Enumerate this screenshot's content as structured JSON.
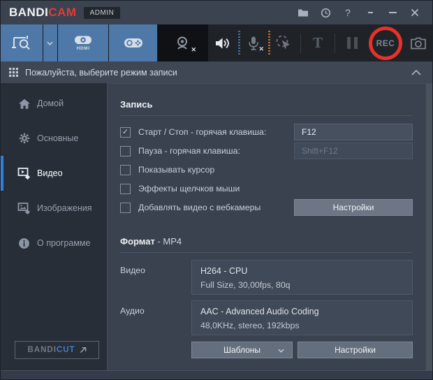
{
  "titlebar": {
    "logo_primary": "BANDI",
    "logo_accent": "CAM",
    "admin_badge": "ADMIN",
    "help_glyph": "?"
  },
  "toolbar": {
    "device_label": "HDMI",
    "text_tool_label": "T",
    "rec_label": "REC",
    "webcam_off_glyph": "✕",
    "mic_off_glyph": "✕"
  },
  "mode_header": {
    "text": "Пожалуйста, выберите режим записи"
  },
  "sidebar": {
    "items": [
      {
        "label": "Домой"
      },
      {
        "label": "Основные"
      },
      {
        "label": "Видео"
      },
      {
        "label": "Изображения"
      },
      {
        "label": "О программе"
      }
    ],
    "bandicut": {
      "primary": "BANDI",
      "accent": "CUT"
    }
  },
  "main": {
    "record": {
      "title": "Запись",
      "rows": [
        {
          "label": "Старт / Стоп - горячая клавиша:",
          "check": "✓",
          "field": "F12"
        },
        {
          "label": "Пауза - горячая клавиша:",
          "check": "",
          "field": "Shift+F12"
        },
        {
          "label": "Показывать курсор",
          "check": ""
        },
        {
          "label": "Эффекты щелчков мыши",
          "check": ""
        },
        {
          "label": "Добавлять видео с вебкамеры",
          "check": "",
          "button": "Настройки"
        }
      ]
    },
    "format": {
      "title": "Формат",
      "value_suffix": " - MP4",
      "video_label": "Видео",
      "video_codec": "H264 - CPU",
      "video_details": "Full Size, 30,00fps, 80q",
      "audio_label": "Аудио",
      "audio_codec": "AAC - Advanced Audio Coding",
      "audio_details": "48,0KHz, stereo, 192kbps",
      "templates_button": "Шаблоны",
      "settings_button": "Настройки"
    }
  },
  "colors": {
    "brand_red": "#e23b36",
    "toolbar_blue": "#4d78a8",
    "accent_blue": "#2f80d8",
    "rec_ring_red": "#e73129",
    "bandicut_blue": "#3f80c6",
    "meter_blue": "#3f6fa3",
    "meter_orange": "#bf6a2a"
  }
}
